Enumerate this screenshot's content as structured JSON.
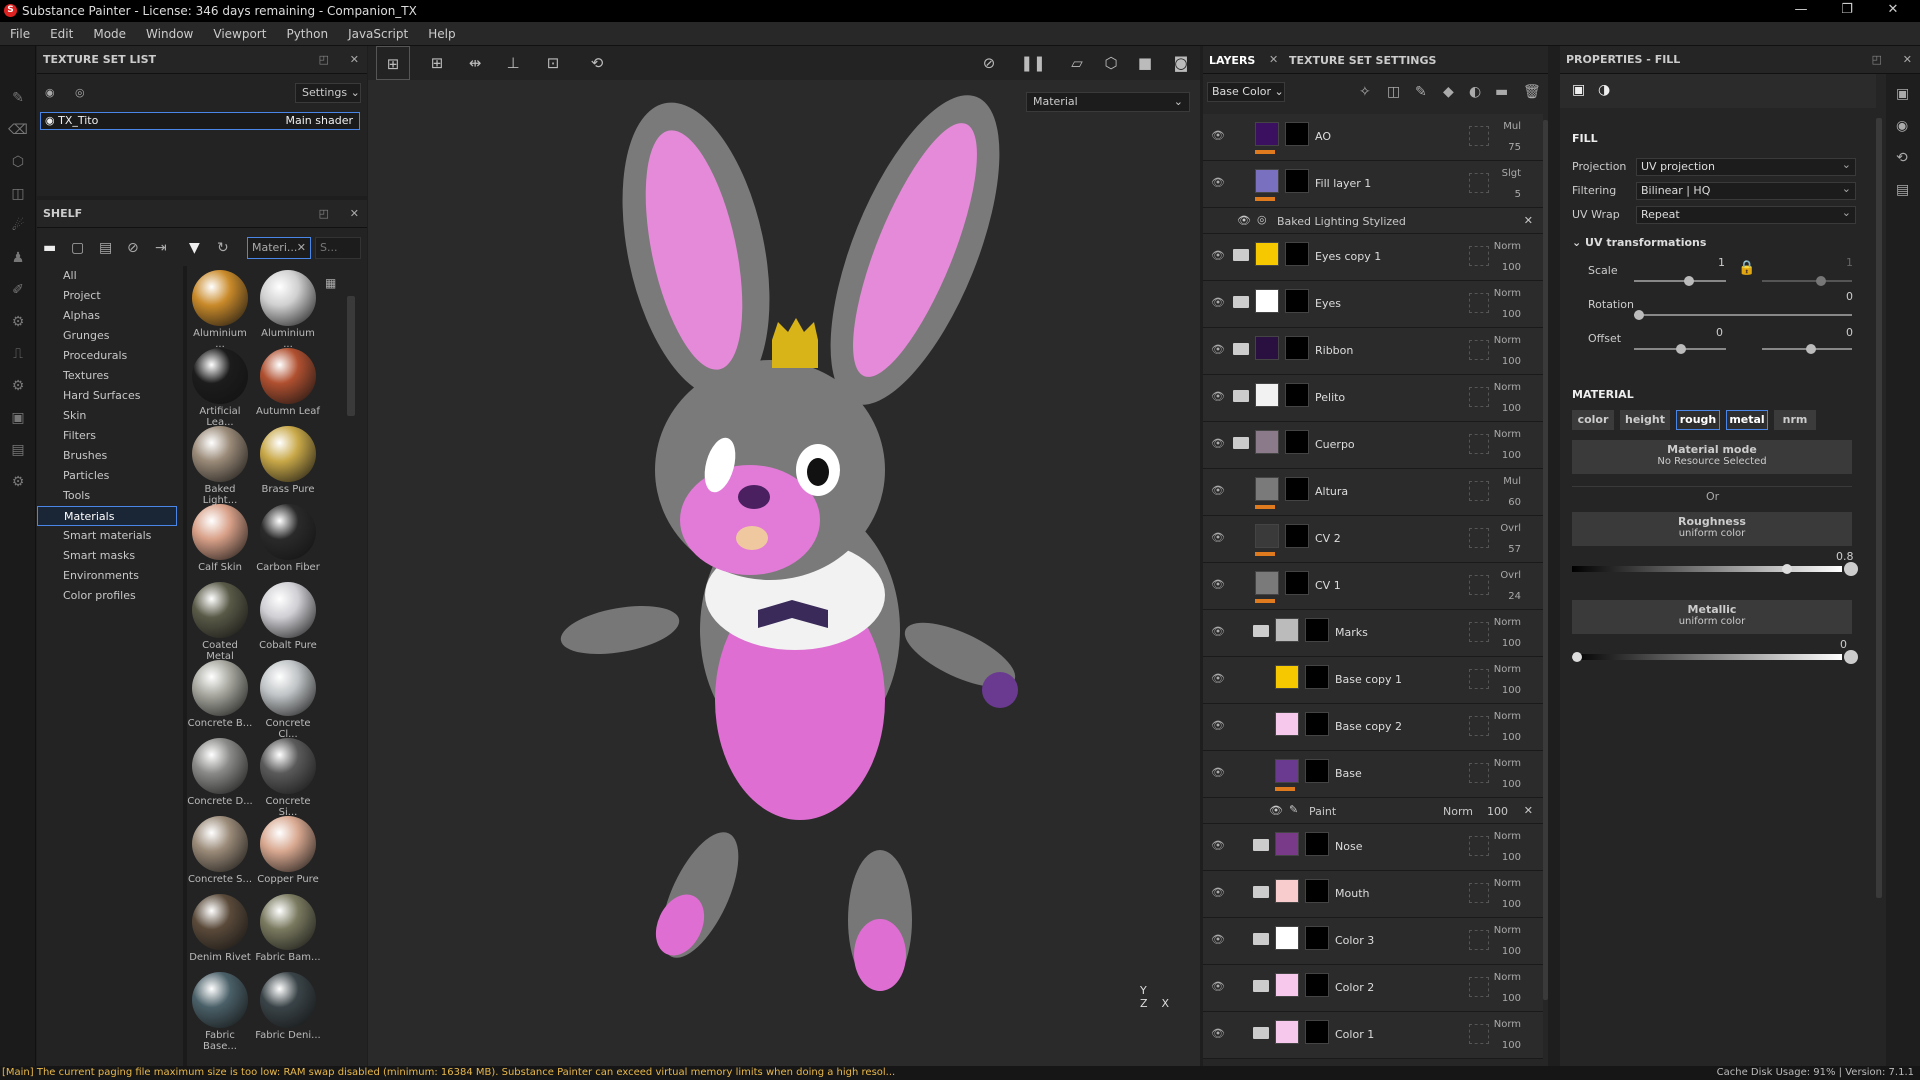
{
  "window": {
    "title": "Substance Painter - License: 346 days remaining - Companion_TX",
    "min": "—",
    "max": "❐",
    "close": "✕"
  },
  "menu": [
    "File",
    "Edit",
    "Mode",
    "Window",
    "Viewport",
    "Python",
    "JavaScript",
    "Help"
  ],
  "texture_set_list": {
    "header": "TEXTURE SET LIST",
    "settings": "Settings",
    "item": "TX_Tito",
    "shader": "Main shader"
  },
  "shelf": {
    "header": "SHELF",
    "filter_tag": "Materi...",
    "search_placeholder": "S...",
    "categories": [
      "All",
      "Project",
      "Alphas",
      "Grunges",
      "Procedurals",
      "Textures",
      "Hard Surfaces",
      "Skin",
      "Filters",
      "Brushes",
      "Particles",
      "Tools",
      "Materials",
      "Smart materials",
      "Smart masks",
      "Environments",
      "Color profiles"
    ],
    "selected_category": "Materials",
    "materials": [
      {
        "name": "Aluminium ...",
        "color": "#c98a2a"
      },
      {
        "name": "Aluminium ...",
        "color": "#d0d0d0"
      },
      {
        "name": "Artificial Lea...",
        "color": "#1c1c1c"
      },
      {
        "name": "Autumn Leaf",
        "color": "#b05030"
      },
      {
        "name": "Baked Light...",
        "color": "#9a8a78"
      },
      {
        "name": "Brass Pure",
        "color": "#c8a848"
      },
      {
        "name": "Calf Skin",
        "color": "#d8a088"
      },
      {
        "name": "Carbon Fiber",
        "color": "#2a2a2a"
      },
      {
        "name": "Coated Metal",
        "color": "#5a5a48"
      },
      {
        "name": "Cobalt Pure",
        "color": "#cfcfd4"
      },
      {
        "name": "Concrete B...",
        "color": "#a8a8a0"
      },
      {
        "name": "Concrete Cl...",
        "color": "#c0c4c6"
      },
      {
        "name": "Concrete D...",
        "color": "#8a8a88"
      },
      {
        "name": "Concrete Si...",
        "color": "#5a5a5a"
      },
      {
        "name": "Concrete S...",
        "color": "#9a8a78"
      },
      {
        "name": "Copper Pure",
        "color": "#d8a890"
      },
      {
        "name": "Denim Rivet",
        "color": "#5a4a3a"
      },
      {
        "name": "Fabric Bam...",
        "color": "#7a7a60"
      },
      {
        "name": "Fabric Base...",
        "color": "#4a6068"
      },
      {
        "name": "Fabric Deni...",
        "color": "#3a4448"
      }
    ]
  },
  "viewport": {
    "mode": "Material"
  },
  "layers_panel": {
    "tab_layers": "LAYERS",
    "tab_tss": "TEXTURE SET SETTINGS",
    "channel": "Base Color",
    "layers": [
      {
        "name": "AO",
        "blend": "Mul",
        "opacity": "75",
        "color": "#3b1060",
        "folder": false,
        "orange": true
      },
      {
        "name": "Fill layer 1",
        "blend": "Slgt",
        "opacity": "5",
        "color": "#7a70c0",
        "folder": false,
        "orange": true
      },
      {
        "name": "Eyes copy 1",
        "blend": "Norm",
        "opacity": "100",
        "color": "#f5c800",
        "folder": true,
        "orange": false
      },
      {
        "name": "Eyes",
        "blend": "Norm",
        "opacity": "100",
        "color": "#ffffff",
        "folder": true,
        "orange": false
      },
      {
        "name": "Ribbon",
        "blend": "Norm",
        "opacity": "100",
        "color": "#2a1040",
        "folder": true,
        "orange": false
      },
      {
        "name": "Pelito",
        "blend": "Norm",
        "opacity": "100",
        "color": "#f2f2f2",
        "folder": true,
        "orange": false
      },
      {
        "name": "Cuerpo",
        "blend": "Norm",
        "opacity": "100",
        "color": "#8a7a8a",
        "folder": true,
        "orange": false
      },
      {
        "name": "Altura",
        "blend": "Mul",
        "opacity": "60",
        "color": "#7a7a7a",
        "folder": false,
        "orange": true
      },
      {
        "name": "CV 2",
        "blend": "Ovrl",
        "opacity": "57",
        "color": "#3a3a3a",
        "folder": false,
        "orange": true
      },
      {
        "name": "CV 1",
        "blend": "Ovrl",
        "opacity": "24",
        "color": "#7a7a7a",
        "folder": false,
        "orange": true
      },
      {
        "name": "Marks",
        "blend": "Norm",
        "opacity": "100",
        "color": "#bbbbbb",
        "folder": true,
        "orange": false
      },
      {
        "name": "Base copy 1",
        "blend": "Norm",
        "opacity": "100",
        "color": "#f5c800",
        "folder": false,
        "orange": false
      },
      {
        "name": "Base copy 2",
        "blend": "Norm",
        "opacity": "100",
        "color": "#f6c8ec",
        "folder": false,
        "orange": false
      },
      {
        "name": "Base",
        "blend": "Norm",
        "opacity": "100",
        "color": "#6a3a90",
        "folder": false,
        "orange": true
      },
      {
        "name": "Nose",
        "blend": "Norm",
        "opacity": "100",
        "color": "#7a3a8a",
        "folder": true,
        "orange": false
      },
      {
        "name": "Mouth",
        "blend": "Norm",
        "opacity": "100",
        "color": "#f8cccc",
        "folder": true,
        "orange": false
      },
      {
        "name": "Color 3",
        "blend": "Norm",
        "opacity": "100",
        "color": "#ffffff",
        "folder": true,
        "orange": false
      },
      {
        "name": "Color 2",
        "blend": "Norm",
        "opacity": "100",
        "color": "#f8c8ec",
        "folder": true,
        "orange": false
      },
      {
        "name": "Color 1",
        "blend": "Norm",
        "opacity": "100",
        "color": "#f6c8ec",
        "folder": true,
        "orange": false
      }
    ],
    "effect_baked": "Baked Lighting Stylized",
    "effect_paint": {
      "name": "Paint",
      "blend": "Norm",
      "opacity": "100"
    }
  },
  "properties": {
    "header": "PROPERTIES - FILL",
    "fill": "FILL",
    "projection_label": "Projection",
    "projection": "UV projection",
    "filtering_label": "Filtering",
    "filtering": "Bilinear | HQ",
    "uvwrap_label": "UV Wrap",
    "uvwrap": "Repeat",
    "uv_transformations": "UV transformations",
    "scale_label": "Scale",
    "scale": "1",
    "scale2": "1",
    "rotation_label": "Rotation",
    "rotation": "0",
    "offset_label": "Offset",
    "offset_x": "0",
    "offset_y": "0",
    "material": "MATERIAL",
    "chips": [
      {
        "label": "color",
        "on": false
      },
      {
        "label": "height",
        "on": false
      },
      {
        "label": "rough",
        "on": true
      },
      {
        "label": "metal",
        "on": true
      },
      {
        "label": "nrm",
        "on": false
      }
    ],
    "material_mode": "Material mode",
    "no_resource": "No Resource Selected",
    "or": "Or",
    "roughness": "Roughness",
    "roughness_sub": "uniform color",
    "roughness_val": "0.8",
    "metallic": "Metallic",
    "metallic_sub": "uniform color",
    "metallic_val": "0"
  },
  "status": {
    "message": "[Main] The current paging file maximum size is too low: RAM swap disabled (minimum: 16384 MB). Substance Painter can exceed virtual memory limits when doing a high resol...",
    "cache": "Cache Disk Usage:  91% | Version: 7.1.1"
  }
}
